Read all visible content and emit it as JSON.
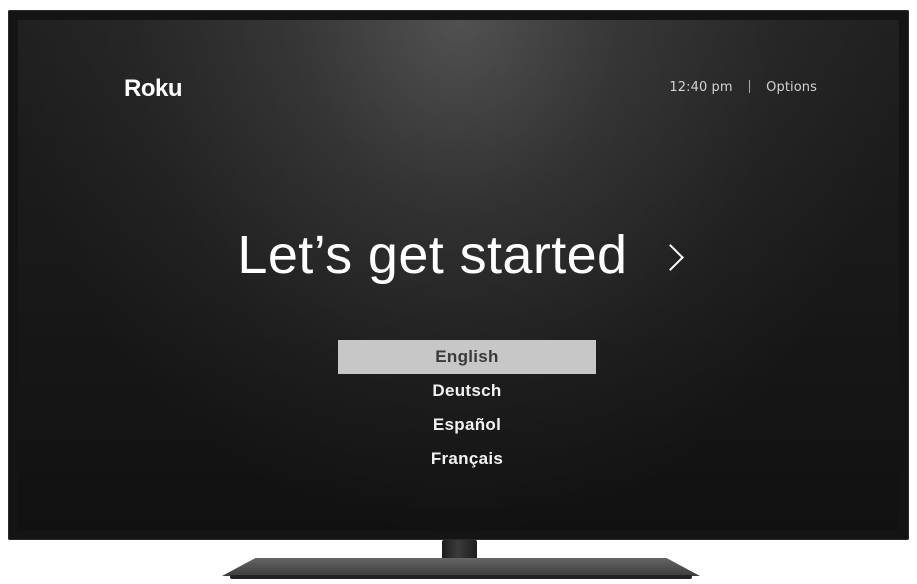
{
  "brand": {
    "logo": "Roku"
  },
  "topbar": {
    "time": "12:40 pm",
    "options": "Options"
  },
  "hero": {
    "title": "Let’s get started"
  },
  "language_menu": {
    "items": [
      "English",
      "Deutsch",
      "Español",
      "Français"
    ],
    "selected": "English"
  },
  "colors": {
    "screen_background": "#151515",
    "selected_item_background": "#c7c7c7",
    "selected_item_text": "#3a3a3a",
    "text": "#ffffff"
  },
  "icons": {
    "next": "chevron-right-icon"
  }
}
